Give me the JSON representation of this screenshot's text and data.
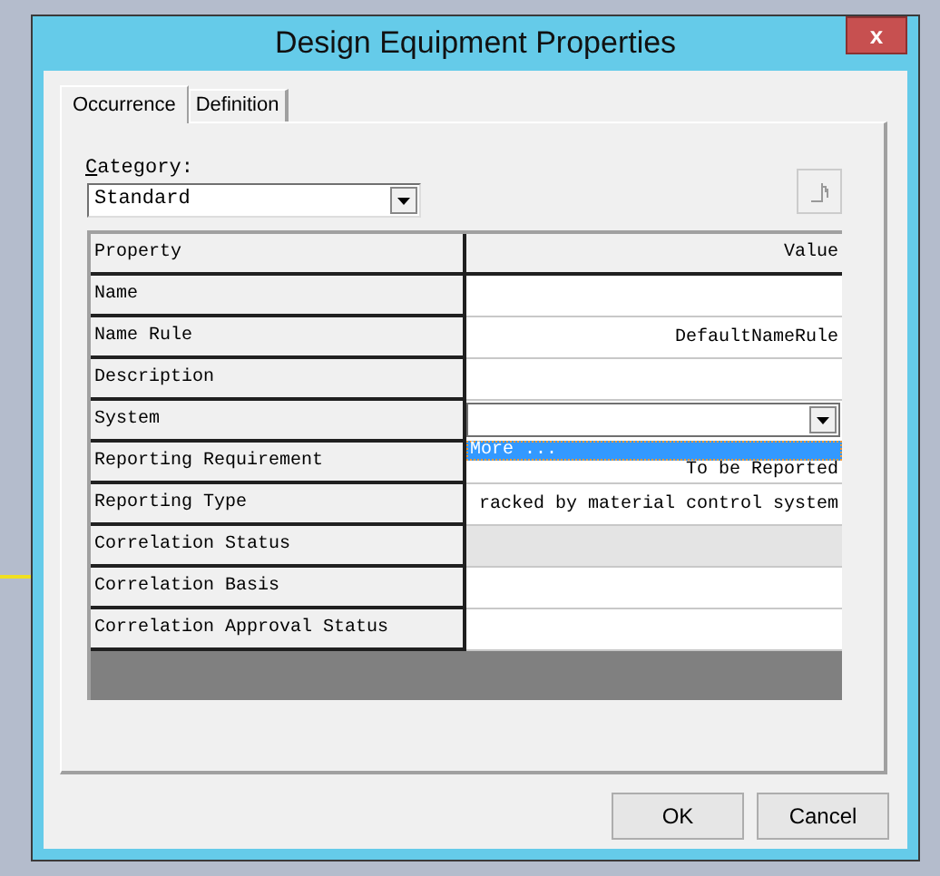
{
  "window": {
    "title": "Design Equipment Properties",
    "close": "x"
  },
  "tabs": [
    {
      "label": "Occurrence",
      "selected": true
    },
    {
      "label": "Definition",
      "selected": false
    }
  ],
  "category": {
    "label": "Category:",
    "value": "Standard"
  },
  "grid": {
    "columns": [
      "Property",
      "Value"
    ],
    "rows": [
      {
        "property": "Name",
        "value": "",
        "readonly": false
      },
      {
        "property": "Name Rule",
        "value": "DefaultNameRule",
        "readonly": false
      },
      {
        "property": "Description",
        "value": "",
        "readonly": false
      },
      {
        "property": "System",
        "value": "",
        "readonly": false,
        "kind": "dropdown",
        "expanded": true,
        "options": [
          {
            "label": "More ...",
            "selected": true
          }
        ]
      },
      {
        "property": "Reporting Requirement",
        "value": "To be Reported",
        "readonly": false
      },
      {
        "property": "Reporting Type",
        "value": "racked by material control system",
        "readonly": false
      },
      {
        "property": "Correlation Status",
        "value": "",
        "readonly": true
      },
      {
        "property": "Correlation Basis",
        "value": "",
        "readonly": false
      },
      {
        "property": "Correlation Approval Status",
        "value": "",
        "readonly": false
      }
    ]
  },
  "buttons": [
    "OK",
    "Cancel"
  ]
}
